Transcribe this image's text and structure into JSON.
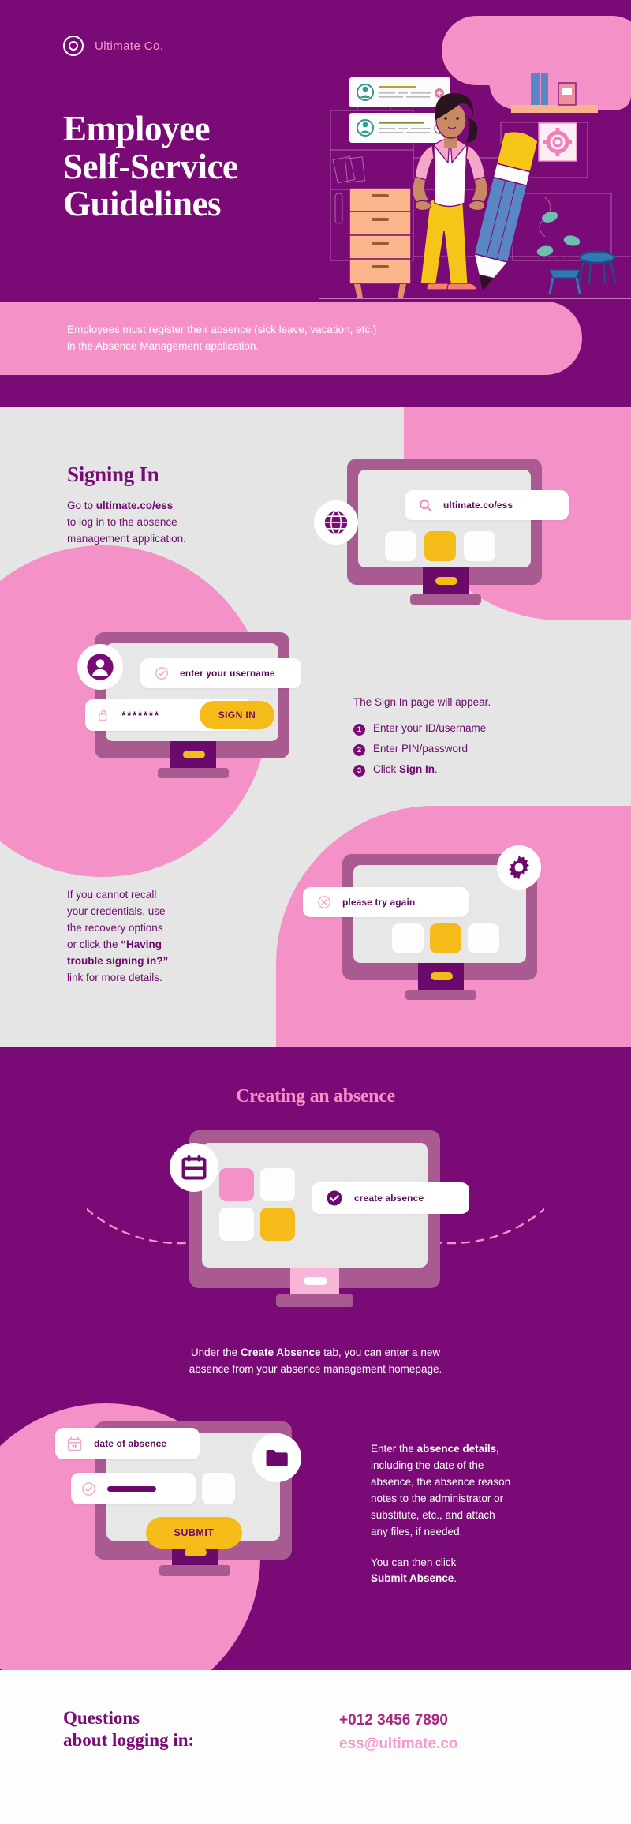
{
  "brand": {
    "name": "Ultimate Co.",
    "logo_icon": "target-icon",
    "colors": {
      "purple_dark": "#7a0a75",
      "purple_deep": "#5d0b5d",
      "pink": "#f491c6",
      "pink_light": "#f7b5d7",
      "grey_bg": "#e6e5e5",
      "yellow": "#f5bc19",
      "white": "#ffffff"
    }
  },
  "hero": {
    "title": "Employee\nSelf-Service\nGuidelines",
    "title_line1": "Employee",
    "title_line2": "Self-Service",
    "title_line3": "Guidelines",
    "banner": "Employees must register their absence (sick leave, vacation, etc.) in the Absence Management application.",
    "banner_line1": "Employees must register their absence (sick leave, vacation, etc.)",
    "banner_line2": "in the Absence Management application.",
    "illustration": {
      "name": "woman-with-pencil-office-illustration",
      "cards": [
        {
          "avatar": "user-avatar-icon",
          "action": "plus-circle-icon"
        },
        {
          "avatar": "user-avatar-icon",
          "action": "plus-circle-icon"
        }
      ],
      "gear_icon": "gear-icon"
    }
  },
  "signing_in": {
    "heading": "Signing In",
    "intro_line1": "Go to ",
    "intro_bold": "ultimate.co/ess",
    "intro_line2": "to log in to the absence",
    "intro_line3": "management application.",
    "url_monitor": {
      "globe_icon": "globe-icon",
      "search_icon": "search-icon",
      "url_value": "ultimate.co/ess"
    },
    "login_monitor": {
      "avatar_icon": "user-avatar-icon",
      "check_icon": "check-circle-icon",
      "username_placeholder": "enter your username",
      "lock_icon": "unlock-icon",
      "password_masked": "*******",
      "sign_in_button": "SIGN IN"
    },
    "steps_intro": "The Sign In page will appear.",
    "steps": [
      {
        "num": "1",
        "text": "Enter your ID/username",
        "bold": ""
      },
      {
        "num": "2",
        "text": "Enter PIN/password",
        "bold": ""
      },
      {
        "num": "3",
        "text": "Click ",
        "bold": "Sign In",
        "after": "."
      }
    ],
    "recovery": {
      "line1": "If you cannot recall",
      "line2": "your credentials, use",
      "line3": "the recovery options",
      "line4_pre": "or click the ",
      "line4_bold": "“Having",
      "line5_bold": "trouble signing in?”",
      "line6": "link for more details."
    },
    "error_monitor": {
      "gear_icon": "gear-icon",
      "error_icon": "x-circle-icon",
      "error_message": "please try again"
    }
  },
  "creating_absence": {
    "heading": "Creating an absence",
    "create_monitor": {
      "calendar_icon": "calendar-icon",
      "check_icon": "check-circle-filled-icon",
      "tab_label": "create absence"
    },
    "caption_line1_pre": "Under the ",
    "caption_line1_bold": "Create Absence",
    "caption_line1_post": " tab, you can enter a new",
    "caption_line2": "absence from your absence management homepage.",
    "date_monitor": {
      "calendar_icon": "calendar-28-icon",
      "calendar_day": "28",
      "date_label": "date of absence",
      "check_icon": "check-circle-icon",
      "folder_icon": "folder-icon",
      "submit_button": "SUBMIT"
    },
    "details": {
      "line1_pre": "Enter the ",
      "line1_bold": "absence details,",
      "line2": "including the date of the",
      "line3": "absence, the absence reason",
      "line4": "notes to the administrator or",
      "line5": "substitute, etc., and attach",
      "line6": "any files, if needed.",
      "line7": "You can then click",
      "line8_bold": "Submit Absence",
      "line8_post": "."
    }
  },
  "footer": {
    "question_line1": "Questions",
    "question_line2": "about logging in:",
    "phone": "+012 3456 7890",
    "email": "ess@ultimate.co"
  }
}
